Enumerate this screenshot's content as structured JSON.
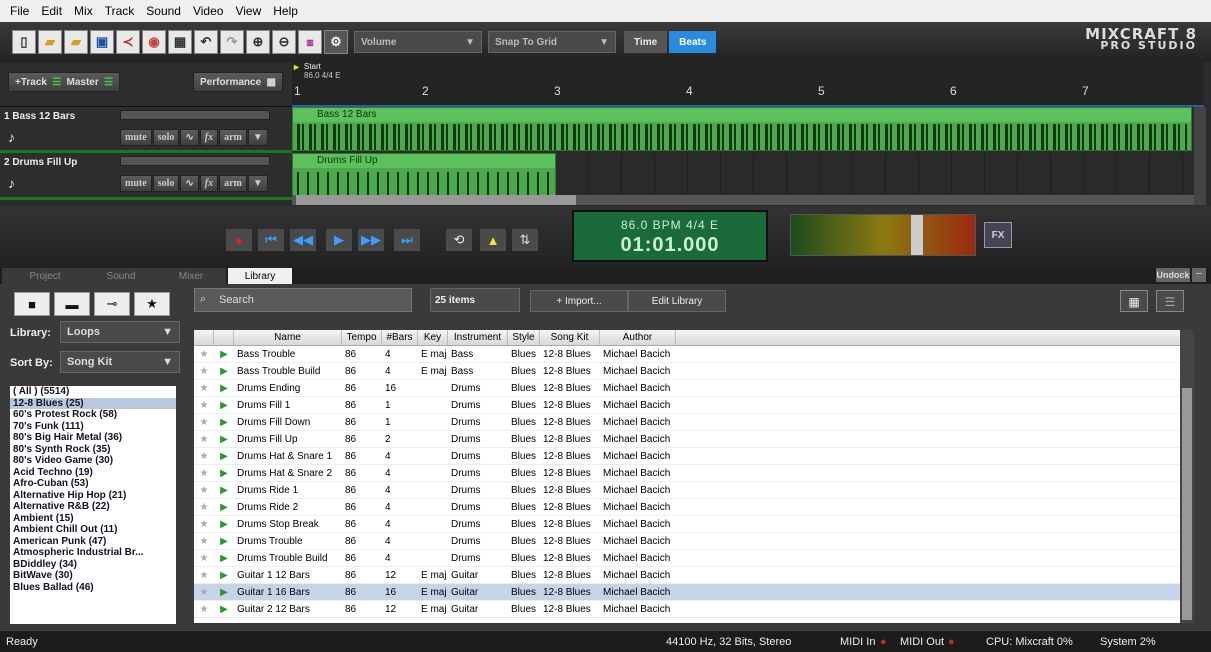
{
  "menu": [
    "File",
    "Edit",
    "Mix",
    "Track",
    "Sound",
    "Video",
    "View",
    "Help"
  ],
  "toolbar": {
    "volume_select": "Volume",
    "snap_select": "Snap To Grid",
    "time_tab": "Time",
    "beats_tab": "Beats",
    "logo_line1": "MIXCRAFT 8",
    "logo_line2": "PRO STUDIO"
  },
  "track_header": {
    "add_track": "+Track",
    "master": "Master",
    "performance": "Performance"
  },
  "ruler": {
    "start_label": "Start",
    "start_info": "86.0 4/4 E",
    "marks": [
      "1",
      "2",
      "3",
      "4",
      "5",
      "6",
      "7"
    ]
  },
  "tracks": [
    {
      "name": "1 Bass 12 Bars",
      "clip": "Bass 12 Bars",
      "controls": [
        "mute",
        "solo",
        "fx",
        "arm"
      ]
    },
    {
      "name": "2 Drums Fill Up",
      "clip": "Drums Fill Up",
      "controls": [
        "mute",
        "solo",
        "fx",
        "arm"
      ]
    }
  ],
  "transport": {
    "bpm_line": "86.0 BPM  4/4   E",
    "time": "01:01.000",
    "fx_button": "FX"
  },
  "tabs": [
    "Project",
    "Sound",
    "Mixer",
    "Library"
  ],
  "undock": "Undock",
  "library": {
    "library_label": "Library:",
    "library_value": "Loops",
    "sortby_label": "Sort By:",
    "sortby_value": "Song Kit",
    "search_placeholder": "Search",
    "item_count": "25 items",
    "import_button": "+ Import...",
    "edit_button": "Edit Library",
    "categories": [
      "( All ) (5514)",
      "12-8 Blues (25)",
      "60's Protest Rock (58)",
      "70's Funk (111)",
      "80's Big Hair Metal (36)",
      "80's Synth Rock (35)",
      "80's Video Game (30)",
      "Acid Techno (19)",
      "Afro-Cuban (53)",
      "Alternative Hip Hop (21)",
      "Alternative R&B (22)",
      "Ambient (15)",
      "Ambient Chill Out (11)",
      "American Punk (47)",
      "Atmospheric Industrial Br...",
      "BDiddley (34)",
      "BitWave (30)",
      "Blues Ballad (46)"
    ],
    "columns": [
      "Name",
      "Tempo",
      "#Bars",
      "Key",
      "Instrument",
      "Style",
      "Song Kit",
      "Author"
    ],
    "rows": [
      {
        "name": "Bass Trouble",
        "tempo": "86",
        "bars": "4",
        "key": "E maj",
        "instrument": "Bass",
        "style": "Blues",
        "kit": "12-8 Blues",
        "author": "Michael Bacich"
      },
      {
        "name": "Bass Trouble Build",
        "tempo": "86",
        "bars": "4",
        "key": "E maj",
        "instrument": "Bass",
        "style": "Blues",
        "kit": "12-8 Blues",
        "author": "Michael Bacich"
      },
      {
        "name": "Drums Ending",
        "tempo": "86",
        "bars": "16",
        "key": "",
        "instrument": "Drums",
        "style": "Blues",
        "kit": "12-8 Blues",
        "author": "Michael Bacich"
      },
      {
        "name": "Drums Fill 1",
        "tempo": "86",
        "bars": "1",
        "key": "",
        "instrument": "Drums",
        "style": "Blues",
        "kit": "12-8 Blues",
        "author": "Michael Bacich"
      },
      {
        "name": "Drums Fill Down",
        "tempo": "86",
        "bars": "1",
        "key": "",
        "instrument": "Drums",
        "style": "Blues",
        "kit": "12-8 Blues",
        "author": "Michael Bacich"
      },
      {
        "name": "Drums Fill Up",
        "tempo": "86",
        "bars": "2",
        "key": "",
        "instrument": "Drums",
        "style": "Blues",
        "kit": "12-8 Blues",
        "author": "Michael Bacich"
      },
      {
        "name": "Drums Hat & Snare 1",
        "tempo": "86",
        "bars": "4",
        "key": "",
        "instrument": "Drums",
        "style": "Blues",
        "kit": "12-8 Blues",
        "author": "Michael Bacich"
      },
      {
        "name": "Drums Hat & Snare 2",
        "tempo": "86",
        "bars": "4",
        "key": "",
        "instrument": "Drums",
        "style": "Blues",
        "kit": "12-8 Blues",
        "author": "Michael Bacich"
      },
      {
        "name": "Drums Ride 1",
        "tempo": "86",
        "bars": "4",
        "key": "",
        "instrument": "Drums",
        "style": "Blues",
        "kit": "12-8 Blues",
        "author": "Michael Bacich"
      },
      {
        "name": "Drums Ride 2",
        "tempo": "86",
        "bars": "4",
        "key": "",
        "instrument": "Drums",
        "style": "Blues",
        "kit": "12-8 Blues",
        "author": "Michael Bacich"
      },
      {
        "name": "Drums Stop Break",
        "tempo": "86",
        "bars": "4",
        "key": "",
        "instrument": "Drums",
        "style": "Blues",
        "kit": "12-8 Blues",
        "author": "Michael Bacich"
      },
      {
        "name": "Drums Trouble",
        "tempo": "86",
        "bars": "4",
        "key": "",
        "instrument": "Drums",
        "style": "Blues",
        "kit": "12-8 Blues",
        "author": "Michael Bacich"
      },
      {
        "name": "Drums Trouble Build",
        "tempo": "86",
        "bars": "4",
        "key": "",
        "instrument": "Drums",
        "style": "Blues",
        "kit": "12-8 Blues",
        "author": "Michael Bacich"
      },
      {
        "name": "Guitar 1 12 Bars",
        "tempo": "86",
        "bars": "12",
        "key": "E maj",
        "instrument": "Guitar",
        "style": "Blues",
        "kit": "12-8 Blues",
        "author": "Michael Bacich"
      },
      {
        "name": "Guitar 1 16 Bars",
        "tempo": "86",
        "bars": "16",
        "key": "E maj",
        "instrument": "Guitar",
        "style": "Blues",
        "kit": "12-8 Blues",
        "author": "Michael Bacich"
      },
      {
        "name": "Guitar 2 12 Bars",
        "tempo": "86",
        "bars": "12",
        "key": "E maj",
        "instrument": "Guitar",
        "style": "Blues",
        "kit": "12-8 Blues",
        "author": "Michael Bacich"
      }
    ]
  },
  "status": {
    "ready": "Ready",
    "audio": "44100 Hz, 32 Bits, Stereo",
    "midi_in": "MIDI In",
    "midi_out": "MIDI Out",
    "cpu": "CPU: Mixcraft 0%",
    "system": "System 2%"
  },
  "colors": {
    "clip_green": "#4fa84f",
    "accent_blue": "#2a8ae0",
    "lcd_green": "#1a6a3a"
  }
}
